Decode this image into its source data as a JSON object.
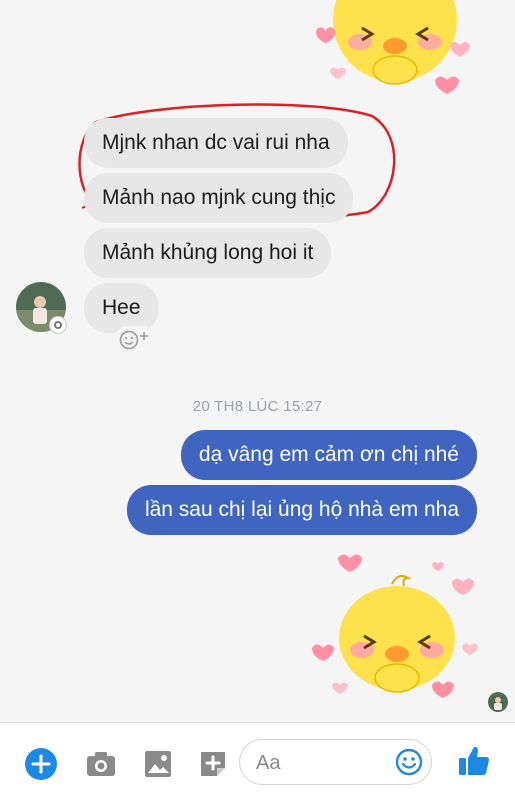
{
  "messages_incoming": [
    {
      "text": "Mjnk nhan dc vai rui nha"
    },
    {
      "text": "Mảnh nao mjnk cung thịc"
    },
    {
      "text": "Mảnh khủng long hoi it"
    },
    {
      "text": "Hee"
    }
  ],
  "timestamp": "20 TH8 LÚC 15:27",
  "messages_outgoing": [
    {
      "text": "dạ vâng em cảm ơn chị nhé"
    },
    {
      "text": "lần sau chị lại ủng hộ nhà em nha"
    }
  ],
  "composer": {
    "placeholder": "Aa"
  },
  "icons": {
    "add": "plus-circle-icon",
    "camera": "camera-icon",
    "gallery": "image-icon",
    "sticker": "sticker-icon",
    "emoji": "emoji-icon",
    "like": "thumbs-up-icon"
  },
  "colors": {
    "accent": "#1e88e5",
    "outgoing_bubble": "#3f65c0",
    "incoming_bubble": "#e7e7e7",
    "annotation": "#e02020"
  }
}
